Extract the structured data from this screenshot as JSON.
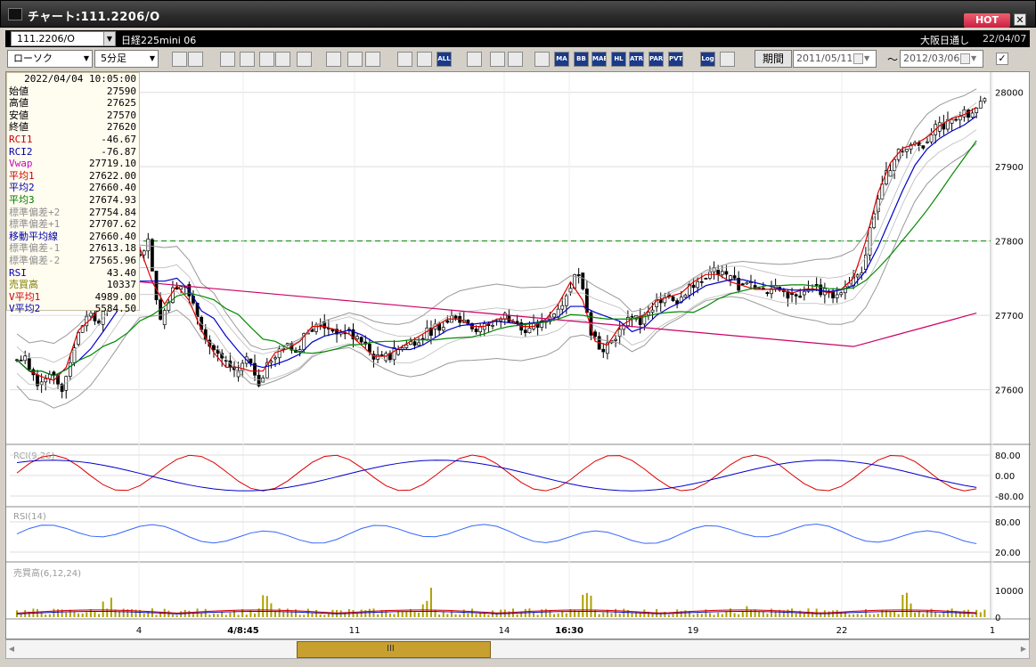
{
  "window": {
    "title": "チャート:111.2206/O",
    "hot_label": "HOT",
    "close_label": "✕"
  },
  "instrument": {
    "symbol": "111.2206/O",
    "name": "日経225mini 06",
    "exchange": "大阪日通し",
    "expiry": "22/04/07"
  },
  "toolbar": {
    "chart_type": "ローソク",
    "interval": "5分足",
    "period_label": "期間",
    "date_from": "2011/05/11",
    "date_to": "2012/03/06",
    "tilde": "〜",
    "buttons": [
      "zoom-icon",
      "crosshair-icon",
      "trend-icon",
      "search-icon",
      "line-icon",
      "marker-icon",
      "info-icon",
      "pen-icon",
      "pointer-icon",
      "undo-icon",
      "cursor1-icon",
      "cursor2-icon",
      "all-icon",
      "palette-icon",
      "brush-icon",
      "color-icon",
      "oscillator-icon",
      "ma-icon",
      "bb-icon",
      "mae-icon",
      "hl-icon",
      "atr-icon",
      "para-icon",
      "pvt-icon",
      "log-icon",
      "export-icon"
    ],
    "button_labels": {
      "all": "ALL",
      "ma": "MA",
      "bb": "BB",
      "mae": "MAE",
      "hl": "HL",
      "atr": "ATR",
      "para": "PARA",
      "pvt": "PVT",
      "log": "Log"
    }
  },
  "info_panel": {
    "timestamp": "2022/04/04  10:05:00",
    "rows": [
      {
        "label": "始値",
        "value": "27590",
        "color": "#000000"
      },
      {
        "label": "高値",
        "value": "27625",
        "color": "#000000"
      },
      {
        "label": "安値",
        "value": "27570",
        "color": "#000000"
      },
      {
        "label": "終値",
        "value": "27620",
        "color": "#000000"
      },
      {
        "label": "RCI1",
        "value": "-46.67",
        "color": "#cc0000"
      },
      {
        "label": "RCI2",
        "value": "-76.87",
        "color": "#0000aa"
      },
      {
        "label": "Vwap",
        "value": "27719.10",
        "color": "#cc00cc"
      },
      {
        "label": "平均1",
        "value": "27622.00",
        "color": "#cc0000"
      },
      {
        "label": "平均2",
        "value": "27660.40",
        "color": "#0000aa"
      },
      {
        "label": "平均3",
        "value": "27674.93",
        "color": "#007700"
      },
      {
        "label": "標準偏差+2",
        "value": "27754.84",
        "color": "#909090"
      },
      {
        "label": "標準偏差+1",
        "value": "27707.62",
        "color": "#909090"
      },
      {
        "label": "移動平均線",
        "value": "27660.40",
        "color": "#0000aa"
      },
      {
        "label": "標準偏差-1",
        "value": "27613.18",
        "color": "#909090"
      },
      {
        "label": "標準偏差-2",
        "value": "27565.96",
        "color": "#909090"
      },
      {
        "label": "RSI",
        "value": "43.40",
        "color": "#0000cc"
      },
      {
        "label": "売買高",
        "value": "10337",
        "color": "#808000"
      },
      {
        "label": "V平均1",
        "value": "4989.00",
        "color": "#cc0000"
      },
      {
        "label": "V平均2",
        "value": "5584.50",
        "color": "#0000aa"
      }
    ]
  },
  "chart_data": {
    "type": "candlestick",
    "price_axis": {
      "ticks": [
        "28000",
        "27900",
        "27800",
        "27700",
        "27600"
      ],
      "range": [
        27530,
        28020
      ]
    },
    "dashed_level": 27800,
    "x_labels": [
      "4",
      "4/8:45",
      "11",
      "14",
      "16:30",
      "19",
      "22",
      "1"
    ],
    "close_series": [
      27640,
      27610,
      27625,
      27600,
      27660,
      27700,
      27690,
      27740,
      27720,
      27780,
      27800,
      27690,
      27740,
      27740,
      27700,
      27660,
      27640,
      27620,
      27640,
      27610,
      27640,
      27660,
      27650,
      27680,
      27690,
      27680,
      27680,
      27670,
      27650,
      27640,
      27650,
      27660,
      27670,
      27680,
      27690,
      27700,
      27690,
      27680,
      27690,
      27700,
      27690,
      27680,
      27690,
      27700,
      27730,
      27760,
      27680,
      27650,
      27670,
      27700,
      27690,
      27710,
      27730,
      27720,
      27740,
      27750,
      27760,
      27750,
      27740,
      27740,
      27730,
      27740,
      27730,
      27730,
      27740,
      27730,
      27730,
      27740,
      27760,
      27840,
      27890,
      27920,
      27930,
      27930,
      27950,
      27960,
      27970,
      27970,
      27990
    ],
    "indicator_panels": [
      {
        "name": "RCI(9,26)",
        "ticks": [
          "80.00",
          "0.00",
          "-80.00"
        ]
      },
      {
        "name": "RSI(14)",
        "ticks": [
          "80.00",
          "20.00"
        ]
      },
      {
        "name": "売買高(6,12,24)",
        "ticks": [
          "10000",
          "0"
        ]
      }
    ],
    "colors": {
      "up": "#ffffff",
      "down": "#000000",
      "ma1": "#dd0000",
      "ma2": "#0000cc",
      "ma3": "#008800",
      "vwap": "#cc0066",
      "bands": "#999999",
      "rsi": "#3366ff",
      "volume": "#b0a000"
    }
  },
  "scroll": {
    "handle_label": "III"
  }
}
